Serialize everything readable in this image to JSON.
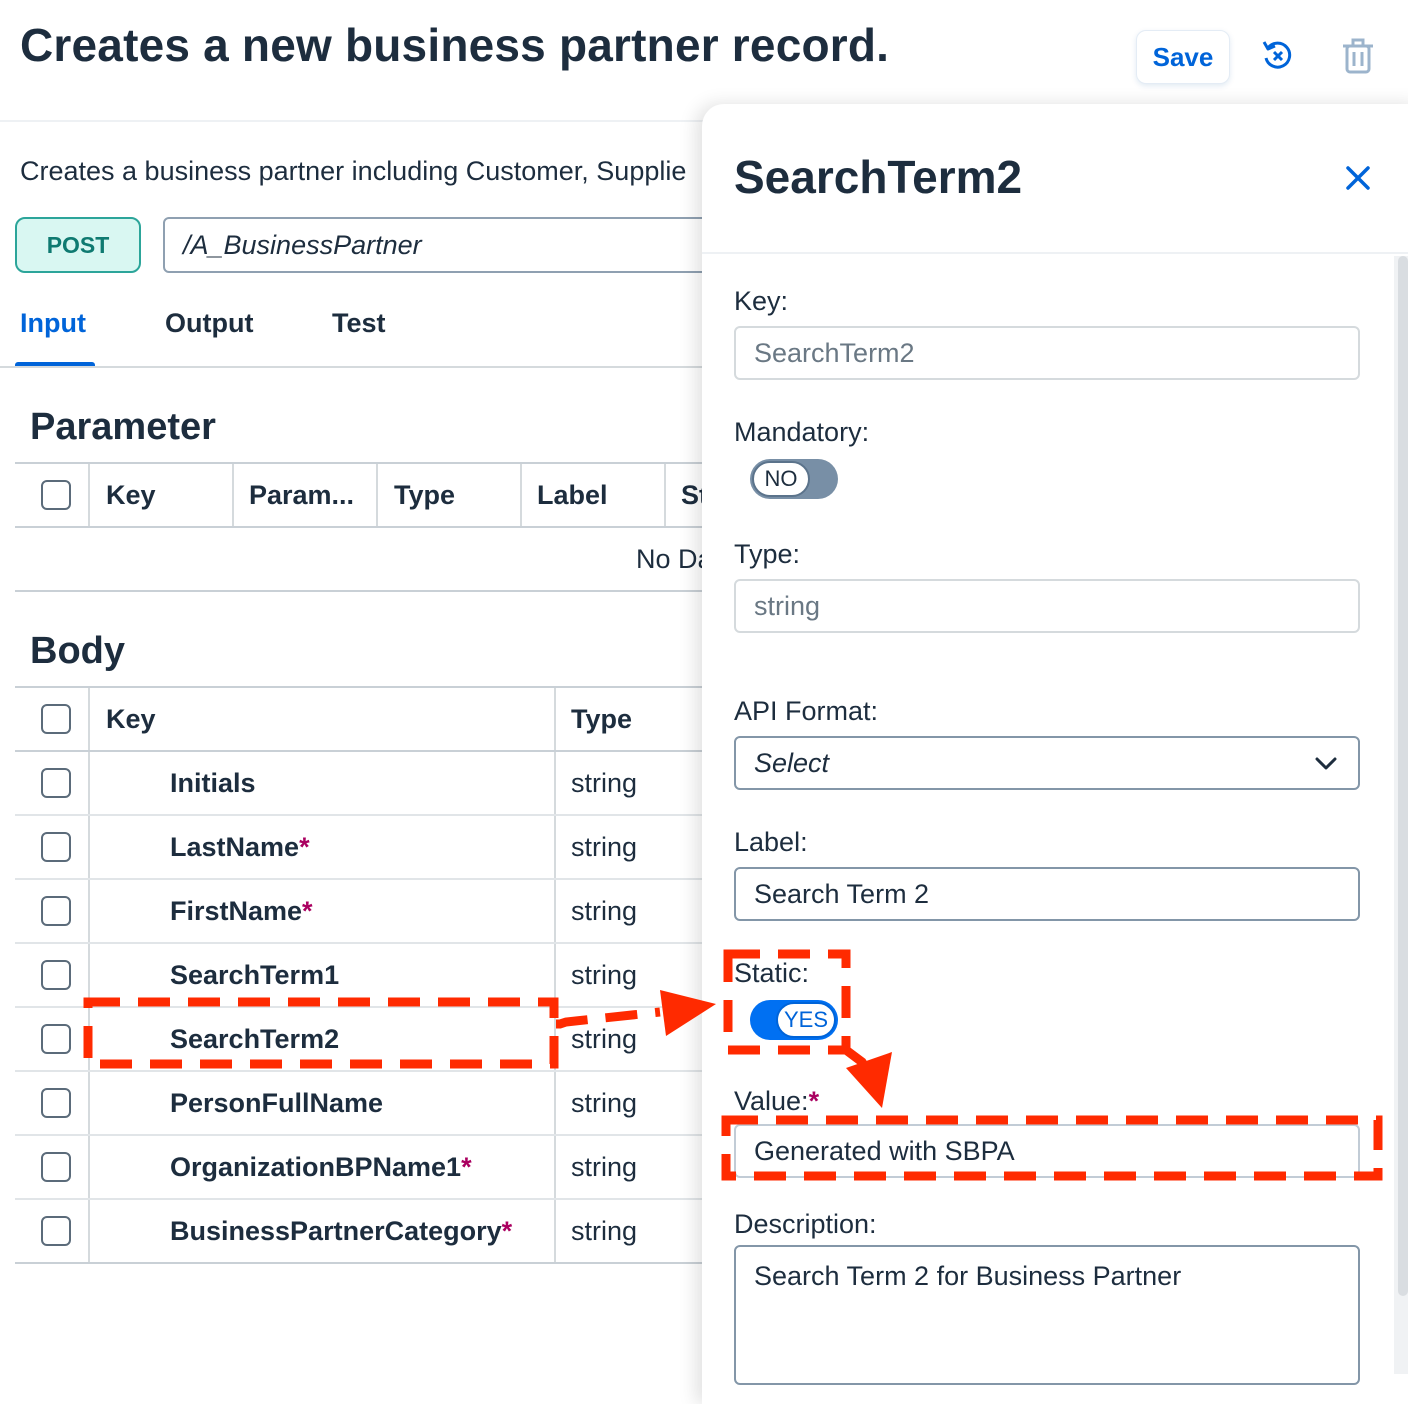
{
  "header": {
    "title": "Creates a new business partner record.",
    "save_label": "Save",
    "reset_icon": "reset-icon",
    "delete_icon": "trash-icon"
  },
  "main": {
    "description": "Creates a business partner including Customer, Supplie",
    "method": "POST",
    "path": "/A_BusinessPartner",
    "tabs": [
      {
        "label": "Input",
        "active": true
      },
      {
        "label": "Output",
        "active": false
      },
      {
        "label": "Test",
        "active": false
      }
    ],
    "parameter": {
      "title": "Parameter",
      "columns": [
        "Key",
        "Param...",
        "Type",
        "Label",
        "St"
      ],
      "no_data": "No Da"
    },
    "body": {
      "title": "Body",
      "columns": [
        "Key",
        "Type"
      ],
      "rows": [
        {
          "key": "Initials",
          "required": "",
          "type": "string"
        },
        {
          "key": "LastName",
          "required": "*",
          "type": "string"
        },
        {
          "key": "FirstName",
          "required": "*",
          "type": "string"
        },
        {
          "key": "SearchTerm1",
          "required": "",
          "type": "string"
        },
        {
          "key": "SearchTerm2",
          "required": "",
          "type": "string"
        },
        {
          "key": "PersonFullName",
          "required": "",
          "type": "string"
        },
        {
          "key": "OrganizationBPName1",
          "required": "*",
          "type": "string"
        },
        {
          "key": "BusinessPartnerCategory",
          "required": "*",
          "type": "string"
        }
      ]
    }
  },
  "panel": {
    "title": "SearchTerm2",
    "key_label": "Key:",
    "key_value": "SearchTerm2",
    "mandatory_label": "Mandatory:",
    "mandatory_toggle": "NO",
    "type_label": "Type:",
    "type_value": "string",
    "apiformat_label": "API Format:",
    "apiformat_value": "Select",
    "label_label": "Label:",
    "label_value": "Search Term 2",
    "static_label": "Static:",
    "static_toggle": "YES",
    "value_label": "Value:",
    "value_required": "*",
    "value_value": "Generated with SBPA",
    "description_label": "Description:",
    "description_value": "Search Term 2 for Business Partner"
  },
  "colors": {
    "accent": "#0064d9",
    "required": "#aa0060",
    "annotation": "#ff2a00",
    "method_bg": "#d9f7f2"
  }
}
